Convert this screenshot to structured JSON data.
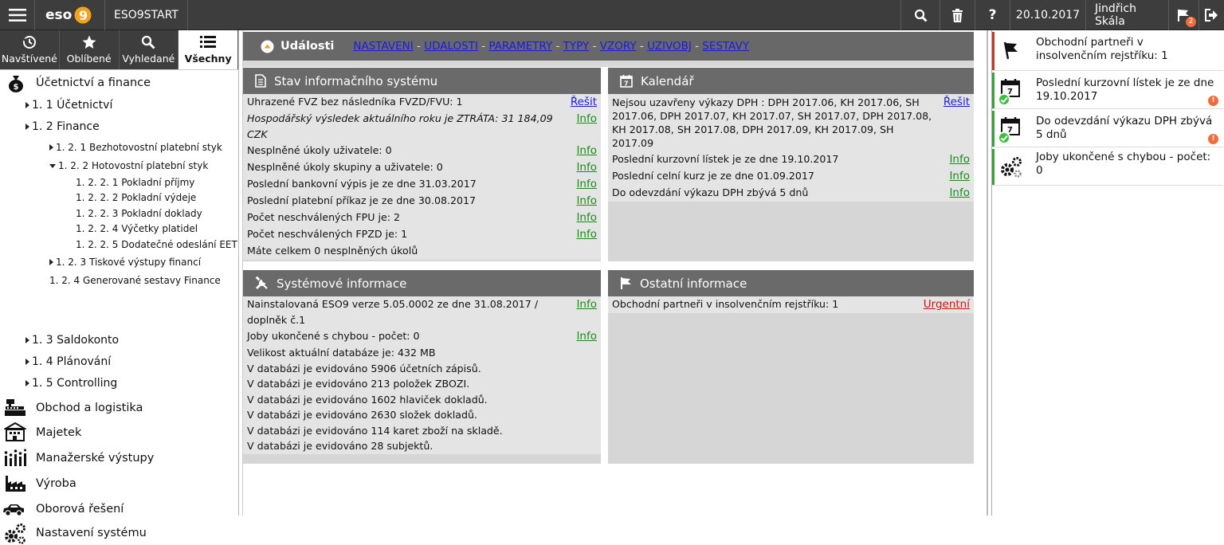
{
  "topbar": {
    "logo": "eso9",
    "app_name": "ESO9START",
    "date": "20.10.2017",
    "user": "Jindřich Skála",
    "notif_count": "2",
    "icons": [
      "menu-icon",
      "search-icon",
      "trash-icon",
      "help-icon",
      "notification-icon",
      "logout-icon"
    ]
  },
  "sidebar": {
    "tabs": [
      {
        "label": "Navštívené",
        "icon": "history-icon"
      },
      {
        "label": "Oblíbené",
        "icon": "star-icon"
      },
      {
        "label": "Vyhledané",
        "icon": "search-icon"
      },
      {
        "label": "Všechny",
        "icon": "list-icon",
        "active": true
      }
    ],
    "tree": [
      {
        "label": "Účetnictví a finance",
        "icon": "money-bag-icon"
      },
      {
        "label": "1. 1 Účetnictví"
      },
      {
        "label": "1. 2 Finance"
      },
      {
        "label": "1. 2. 1 Bezhotovostní platební styk"
      },
      {
        "label": "1. 2. 2 Hotovostní platební styk"
      },
      {
        "label": "1. 2. 2. 1 Pokladní příjmy"
      },
      {
        "label": "1. 2. 2. 2 Pokladní výdeje"
      },
      {
        "label": "1. 2. 2. 3 Pokladní doklady"
      },
      {
        "label": "1. 2. 2. 4 Výčetky platidel"
      },
      {
        "label": "1. 2. 2. 5 Dodatečné odeslání EET"
      },
      {
        "label": "1. 2. 3 Tiskové výstupy financí"
      },
      {
        "label": "1. 2. 4 Generované sestavy Finance"
      },
      {
        "label": "1. 3 Saldokonto"
      },
      {
        "label": "1. 4 Plánování"
      },
      {
        "label": "1. 5 Controlling"
      },
      {
        "label": "Obchod a logistika",
        "icon": "cash-register-icon"
      },
      {
        "label": "Majetek",
        "icon": "building-icon"
      },
      {
        "label": "Manažerské výstupy",
        "icon": "bar-chart-icon"
      },
      {
        "label": "Výroba",
        "icon": "factory-icon"
      },
      {
        "label": "Oborová řešení",
        "icon": "car-icon"
      },
      {
        "label": "Nastavení systému",
        "icon": "gears-icon"
      }
    ]
  },
  "events": {
    "title": "Události",
    "links": [
      "NASTAVENI",
      "UDALOSTI",
      "PARAMETRY",
      "TYPY",
      "VZORY",
      "UZIVOBJ",
      "SESTAVY"
    ],
    "separator": "-"
  },
  "panels": {
    "stav": {
      "title": "Stav informačního systému",
      "rows": [
        {
          "text": "Uhrazené FVZ bez následníka FVZD/FVU: 1",
          "link": "Řešit"
        },
        {
          "text": "Hospodářský výsledek aktuálního roku je ZTRÁTA: 31 184,09 CZK",
          "link": "Info"
        },
        {
          "text": "Nesplněné úkoly uživatele: 0",
          "link": "Info"
        },
        {
          "text": "Nesplněné úkoly skupiny a uživatele: 0",
          "link": "Info"
        },
        {
          "text": "Poslední bankovní výpis je ze dne 31.03.2017",
          "link": "Info"
        },
        {
          "text": "Poslední platební příkaz je ze dne 30.08.2017",
          "link": "Info"
        },
        {
          "text": "Počet neschválených FPU je: 2",
          "link": "Info"
        },
        {
          "text": "Počet neschválených FPZD je: 1",
          "link": "Info"
        },
        {
          "text": "Máte celkem 0 nesplněných úkolů",
          "link": ""
        }
      ]
    },
    "kalendar": {
      "title": "Kalendář",
      "rows": [
        {
          "text": "Nejsou uzavřeny výkazy DPH : DPH 2017.06, KH 2017.06, SH 2017.06, DPH 2017.07, KH 2017.07, SH 2017.07, DPH 2017.08, KH 2017.08, SH 2017.08, DPH 2017.09, KH 2017.09, SH 2017.09",
          "link": "Řešit"
        },
        {
          "text": "Poslední kurzovní lístek je ze dne 19.10.2017",
          "link": "Info"
        },
        {
          "text": "Poslední celní kurz je ze dne 01.09.2017",
          "link": "Info"
        },
        {
          "text": "Do odevzdání výkazu DPH zbývá 5 dnů",
          "link": "Info"
        }
      ]
    },
    "system": {
      "title": "Systémové informace",
      "rows": [
        {
          "text": "Nainstalovaná ESO9 verze 5.05.0002 ze dne 31.08.2017 / doplněk č.1",
          "link": "Info"
        },
        {
          "text": "Joby ukončené s chybou - počet: 0",
          "link": "Info"
        },
        {
          "text": "Velikost aktuální databáze je: 432 MB",
          "link": ""
        },
        {
          "text": "V databázi je evidováno 5906 účetních zápisů.",
          "link": ""
        },
        {
          "text": "V databázi je evidováno 213 položek ZBOZI.",
          "link": ""
        },
        {
          "text": "V databázi je evidováno 1602 hlaviček dokladů.",
          "link": ""
        },
        {
          "text": "V databázi je evidováno 2630 složek dokladů.",
          "link": ""
        },
        {
          "text": "V databázi je evidováno 114 karet zboží na skladě.",
          "link": ""
        },
        {
          "text": "V databázi je evidováno 28 subjektů.",
          "link": ""
        }
      ]
    },
    "ostatni": {
      "title": "Ostatní informace",
      "rows": [
        {
          "text": "Obchodní partneři v insolvenčním rejstříku: 1",
          "link": "Urgentní"
        }
      ]
    }
  },
  "notifications": [
    {
      "text": "Obchodní partneři v insolvenčním rejstříku: 1",
      "icon": "flag-icon",
      "status_color": "#c0392b"
    },
    {
      "text": "Poslední kurzovní lístek je ze dne 19.10.2017",
      "icon": "calendar-icon",
      "status_color": "#3aa03a",
      "badge": "!"
    },
    {
      "text": "Do odevzdání výkazu DPH zbývá 5 dnů",
      "icon": "calendar-icon",
      "status_color": "#3aa03a",
      "badge": "!"
    },
    {
      "text": "Joby ukončené s chybou - počet: 0",
      "icon": "gears-icon",
      "status_color": "#3aa03a"
    }
  ],
  "calendar_icon_day": "7",
  "colors": {
    "topbar": "#3d3d3d",
    "panel_head": "#6a6a6a",
    "info_link": "#1a8a1a",
    "action_link": "#1a1ae6",
    "urgent_link": "#d01010"
  }
}
